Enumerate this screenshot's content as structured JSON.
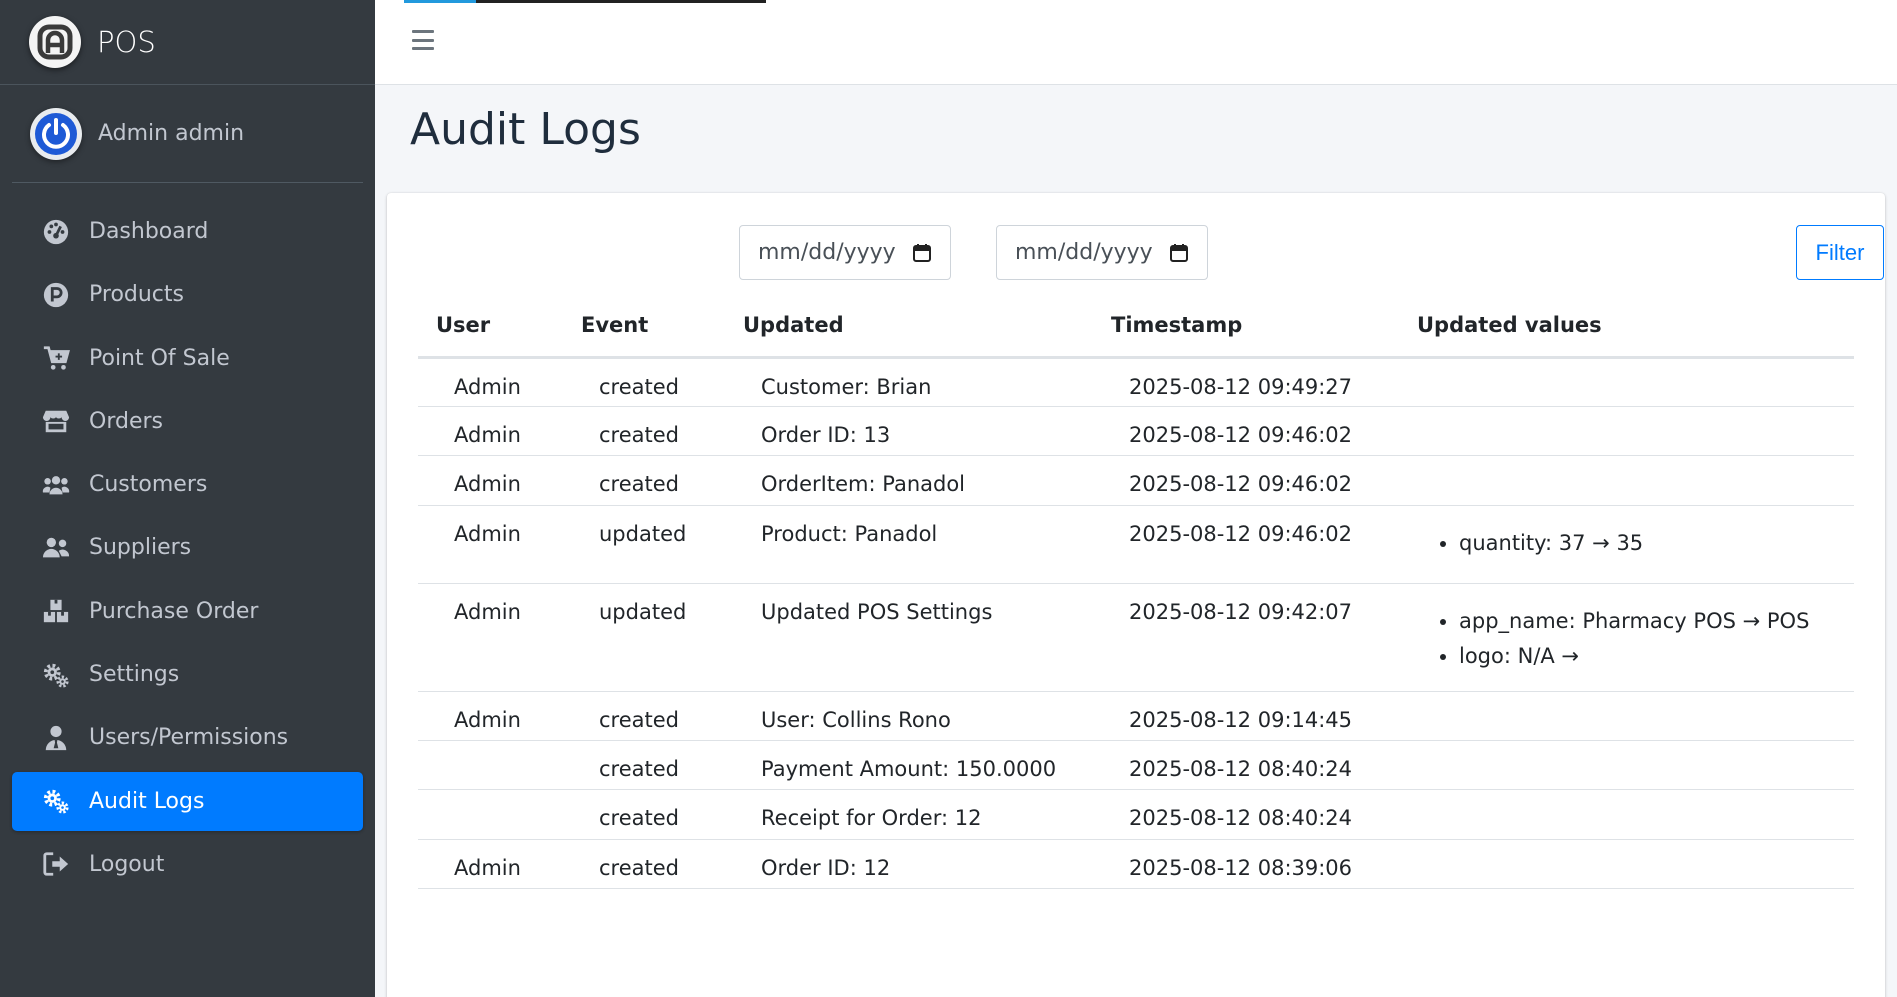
{
  "brand": {
    "name": "POS",
    "logo_icon": "brand-logo-icon"
  },
  "user": {
    "name": "Admin admin",
    "avatar_icon": "power-icon"
  },
  "sidebar": {
    "items": [
      {
        "label": "Dashboard",
        "icon": "tachometer-icon",
        "active": false
      },
      {
        "label": "Products",
        "icon": "product-p-icon",
        "active": false
      },
      {
        "label": "Point Of Sale",
        "icon": "cart-plus-icon",
        "active": false
      },
      {
        "label": "Orders",
        "icon": "store-icon",
        "active": false
      },
      {
        "label": "Customers",
        "icon": "users-icon",
        "active": false
      },
      {
        "label": "Suppliers",
        "icon": "user-friends-icon",
        "active": false
      },
      {
        "label": "Purchase Order",
        "icon": "boxes-icon",
        "active": false
      },
      {
        "label": "Settings",
        "icon": "cogs-icon",
        "active": false
      },
      {
        "label": "Users/Permissions",
        "icon": "user-tie-icon",
        "active": false
      },
      {
        "label": "Audit Logs",
        "icon": "cogs-icon",
        "active": true
      },
      {
        "label": "Logout",
        "icon": "sign-out-icon",
        "active": false
      }
    ]
  },
  "topbar": {
    "menu_icon": "hamburger-icon",
    "loading_progress_percent": 20
  },
  "page": {
    "title": "Audit Logs"
  },
  "filters": {
    "start_date_placeholder": "mm/dd/yyyy",
    "end_date_placeholder": "mm/dd/yyyy",
    "filter_label": "Filter"
  },
  "table": {
    "headers": {
      "user": "User",
      "event": "Event",
      "updated": "Updated",
      "timestamp": "Timestamp",
      "values": "Updated values"
    },
    "rows": [
      {
        "user": "Admin",
        "event": "created",
        "updated": "Customer: Brian",
        "timestamp": "2025-08-12 09:49:27",
        "values": []
      },
      {
        "user": "Admin",
        "event": "created",
        "updated": "Order ID: 13",
        "timestamp": "2025-08-12 09:46:02",
        "values": []
      },
      {
        "user": "Admin",
        "event": "created",
        "updated": "OrderItem: Panadol",
        "timestamp": "2025-08-12 09:46:02",
        "values": []
      },
      {
        "user": "Admin",
        "event": "updated",
        "updated": "Product: Panadol",
        "timestamp": "2025-08-12 09:46:02",
        "values": [
          "quantity: 37 → 35"
        ]
      },
      {
        "user": "Admin",
        "event": "updated",
        "updated": "Updated POS Settings",
        "timestamp": "2025-08-12 09:42:07",
        "values": [
          "app_name: Pharmacy POS → POS",
          "logo: N/A →"
        ]
      },
      {
        "user": "Admin",
        "event": "created",
        "updated": "User: Collins Rono",
        "timestamp": "2025-08-12 09:14:45",
        "values": []
      },
      {
        "user": "",
        "event": "created",
        "updated": "Payment Amount: 150.0000",
        "timestamp": "2025-08-12 08:40:24",
        "values": []
      },
      {
        "user": "",
        "event": "created",
        "updated": "Receipt for Order: 12",
        "timestamp": "2025-08-12 08:40:24",
        "values": []
      },
      {
        "user": "Admin",
        "event": "created",
        "updated": "Order ID: 12",
        "timestamp": "2025-08-12 08:39:06",
        "values": []
      }
    ]
  },
  "colors": {
    "sidebar_bg": "#343a40",
    "accent": "#007bff",
    "page_bg": "#f4f6f9"
  }
}
